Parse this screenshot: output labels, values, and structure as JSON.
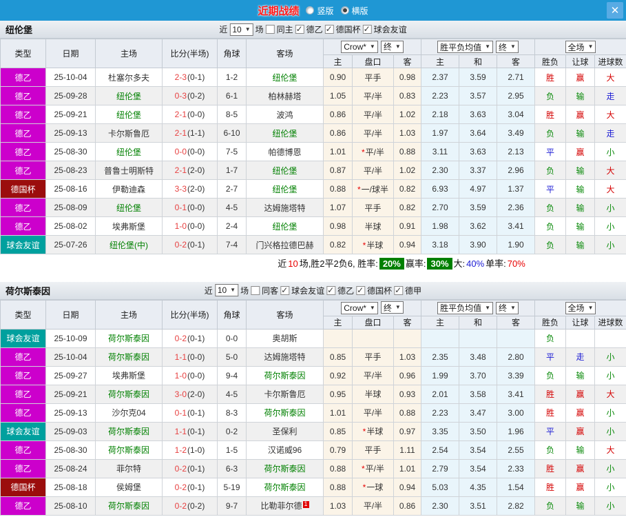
{
  "titlebar": {
    "title": "近期战绩",
    "options": [
      {
        "label": "竖版",
        "selected": false
      },
      {
        "label": "横版",
        "selected": true
      }
    ],
    "close_label": "✕"
  },
  "labels": {
    "near": "近",
    "games": "场"
  },
  "colors": {
    "header_bar": "#1f97d4",
    "league_de2": "#cc00cc",
    "league_cup": "#9b0d0d",
    "league_friendly": "#00a09e",
    "win_badge_bg": "#008000"
  },
  "type_colors": {
    "德乙": "#cc00cc",
    "德国杯": "#9b0d0d",
    "球会友谊": "#00a09e",
    "德甲": "#cc00cc"
  },
  "table_header": {
    "cols": [
      "类型",
      "日期",
      "主场",
      "比分(半场)",
      "角球",
      "客场"
    ],
    "sub": [
      "主",
      "盘口",
      "客",
      "主",
      "和",
      "客",
      "胜负",
      "让球",
      "进球数"
    ],
    "company": "Crow*",
    "final1": "终",
    "avg": "胜平负均值",
    "final2": "终",
    "scope": "全场"
  },
  "teams": [
    {
      "name": "纽伦堡",
      "filter": {
        "count": "10",
        "same": {
          "label": "同主",
          "checked": false
        },
        "leagues": [
          {
            "label": "德乙",
            "checked": true
          },
          {
            "label": "德国杯",
            "checked": true
          },
          {
            "label": "球会友谊",
            "checked": true
          }
        ]
      },
      "rows": [
        {
          "type": "德乙",
          "date": "25-10-04",
          "home": "杜塞尔多夫",
          "home_focus": false,
          "ft": "2-3",
          "ht": "(0-1)",
          "corner": "1-2",
          "away": "纽伦堡",
          "away_focus": true,
          "away_badge": "",
          "o1": "0.90",
          "star": "",
          "handicap": "平手",
          "o2": "0.98",
          "a1": "2.37",
          "a2": "3.59",
          "a3": "2.71",
          "r1": "胜",
          "r2": "赢",
          "r3": "大"
        },
        {
          "type": "德乙",
          "date": "25-09-28",
          "home": "纽伦堡",
          "home_focus": true,
          "ft": "0-3",
          "ht": "(0-2)",
          "corner": "6-1",
          "away": "柏林赫塔",
          "away_focus": false,
          "away_badge": "",
          "o1": "1.05",
          "star": "",
          "handicap": "平/半",
          "o2": "0.83",
          "a1": "2.23",
          "a2": "3.57",
          "a3": "2.95",
          "r1": "负",
          "r2": "输",
          "r3": "走"
        },
        {
          "type": "德乙",
          "date": "25-09-21",
          "home": "纽伦堡",
          "home_focus": true,
          "ft": "2-1",
          "ht": "(0-0)",
          "corner": "8-5",
          "away": "波鸿",
          "away_focus": false,
          "away_badge": "",
          "o1": "0.86",
          "star": "",
          "handicap": "平/半",
          "o2": "1.02",
          "a1": "2.18",
          "a2": "3.63",
          "a3": "3.04",
          "r1": "胜",
          "r2": "赢",
          "r3": "大"
        },
        {
          "type": "德乙",
          "date": "25-09-13",
          "home": "卡尔斯鲁厄",
          "home_focus": false,
          "ft": "2-1",
          "ht": "(1-1)",
          "corner": "6-10",
          "away": "纽伦堡",
          "away_focus": true,
          "away_badge": "",
          "o1": "0.86",
          "star": "",
          "handicap": "平/半",
          "o2": "1.03",
          "a1": "1.97",
          "a2": "3.64",
          "a3": "3.49",
          "r1": "负",
          "r2": "输",
          "r3": "走"
        },
        {
          "type": "德乙",
          "date": "25-08-30",
          "home": "纽伦堡",
          "home_focus": true,
          "ft": "0-0",
          "ht": "(0-0)",
          "corner": "7-5",
          "away": "帕德博恩",
          "away_focus": false,
          "away_badge": "",
          "o1": "1.01",
          "star": "*",
          "handicap": "平/半",
          "o2": "0.88",
          "a1": "3.11",
          "a2": "3.63",
          "a3": "2.13",
          "r1": "平",
          "r2": "赢",
          "r3": "小"
        },
        {
          "type": "德乙",
          "date": "25-08-23",
          "home": "普鲁士明斯特",
          "home_focus": false,
          "ft": "2-1",
          "ht": "(2-0)",
          "corner": "1-7",
          "away": "纽伦堡",
          "away_focus": true,
          "away_badge": "",
          "o1": "0.87",
          "star": "",
          "handicap": "平/半",
          "o2": "1.02",
          "a1": "2.30",
          "a2": "3.37",
          "a3": "2.96",
          "r1": "负",
          "r2": "输",
          "r3": "大"
        },
        {
          "type": "德国杯",
          "date": "25-08-16",
          "home": "伊勒迪森",
          "home_focus": false,
          "ft": "3-3",
          "ht": "(2-0)",
          "corner": "2-7",
          "away": "纽伦堡",
          "away_focus": true,
          "away_badge": "",
          "o1": "0.88",
          "star": "*",
          "handicap": "一/球半",
          "o2": "0.82",
          "a1": "6.93",
          "a2": "4.97",
          "a3": "1.37",
          "r1": "平",
          "r2": "输",
          "r3": "大"
        },
        {
          "type": "德乙",
          "date": "25-08-09",
          "home": "纽伦堡",
          "home_focus": true,
          "ft": "0-1",
          "ht": "(0-0)",
          "corner": "4-5",
          "away": "达姆施塔特",
          "away_focus": false,
          "away_badge": "",
          "o1": "1.07",
          "star": "",
          "handicap": "平手",
          "o2": "0.82",
          "a1": "2.70",
          "a2": "3.59",
          "a3": "2.36",
          "r1": "负",
          "r2": "输",
          "r3": "小"
        },
        {
          "type": "德乙",
          "date": "25-08-02",
          "home": "埃弗斯堡",
          "home_focus": false,
          "ft": "1-0",
          "ht": "(0-0)",
          "corner": "2-4",
          "away": "纽伦堡",
          "away_focus": true,
          "away_badge": "",
          "o1": "0.98",
          "star": "",
          "handicap": "半球",
          "o2": "0.91",
          "a1": "1.98",
          "a2": "3.62",
          "a3": "3.41",
          "r1": "负",
          "r2": "输",
          "r3": "小"
        },
        {
          "type": "球会友谊",
          "date": "25-07-26",
          "home": "纽伦堡(中)",
          "home_focus": true,
          "ft": "0-2",
          "ht": "(0-1)",
          "corner": "7-4",
          "away": "门兴格拉德巴赫",
          "away_focus": false,
          "away_badge": "",
          "o1": "0.82",
          "star": "*",
          "handicap": "半球",
          "o2": "0.94",
          "a1": "3.18",
          "a2": "3.90",
          "a3": "1.90",
          "r1": "负",
          "r2": "输",
          "r3": "小"
        }
      ],
      "summary": {
        "prefix": "近",
        "games": "10",
        "record": "场,胜2平2负6, 胜率:",
        "win": "20%",
        "cover_label": "赢率:",
        "cover": "30%",
        "big_label": "大:",
        "big": "40%",
        "single_label": "单率:",
        "single": "70%"
      }
    },
    {
      "name": "荷尔斯泰因",
      "filter": {
        "count": "10",
        "same": {
          "label": "同客",
          "checked": false
        },
        "leagues": [
          {
            "label": "球会友谊",
            "checked": true
          },
          {
            "label": "德乙",
            "checked": true
          },
          {
            "label": "德国杯",
            "checked": true
          },
          {
            "label": "德甲",
            "checked": true
          }
        ]
      },
      "rows": [
        {
          "type": "球会友谊",
          "date": "25-10-09",
          "home": "荷尔斯泰因",
          "home_focus": true,
          "ft": "0-2",
          "ht": "(0-1)",
          "corner": "0-0",
          "away": "奥胡斯",
          "away_focus": false,
          "away_badge": "",
          "o1": "",
          "star": "",
          "handicap": "",
          "o2": "",
          "a1": "",
          "a2": "",
          "a3": "",
          "r1": "负",
          "r2": "",
          "r3": ""
        },
        {
          "type": "德乙",
          "date": "25-10-04",
          "home": "荷尔斯泰因",
          "home_focus": true,
          "ft": "1-1",
          "ht": "(0-0)",
          "corner": "5-0",
          "away": "达姆施塔特",
          "away_focus": false,
          "away_badge": "",
          "o1": "0.85",
          "star": "",
          "handicap": "平手",
          "o2": "1.03",
          "a1": "2.35",
          "a2": "3.48",
          "a3": "2.80",
          "r1": "平",
          "r2": "走",
          "r3": "小"
        },
        {
          "type": "德乙",
          "date": "25-09-27",
          "home": "埃弗斯堡",
          "home_focus": false,
          "ft": "1-0",
          "ht": "(0-0)",
          "corner": "9-4",
          "away": "荷尔斯泰因",
          "away_focus": true,
          "away_badge": "",
          "o1": "0.92",
          "star": "",
          "handicap": "平/半",
          "o2": "0.96",
          "a1": "1.99",
          "a2": "3.70",
          "a3": "3.39",
          "r1": "负",
          "r2": "输",
          "r3": "小"
        },
        {
          "type": "德乙",
          "date": "25-09-21",
          "home": "荷尔斯泰因",
          "home_focus": true,
          "ft": "3-0",
          "ht": "(2-0)",
          "corner": "4-5",
          "away": "卡尔斯鲁厄",
          "away_focus": false,
          "away_badge": "",
          "o1": "0.95",
          "star": "",
          "handicap": "半球",
          "o2": "0.93",
          "a1": "2.01",
          "a2": "3.58",
          "a3": "3.41",
          "r1": "胜",
          "r2": "赢",
          "r3": "大"
        },
        {
          "type": "德乙",
          "date": "25-09-13",
          "home": "沙尔克04",
          "home_focus": false,
          "ft": "0-1",
          "ht": "(0-1)",
          "corner": "8-3",
          "away": "荷尔斯泰因",
          "away_focus": true,
          "away_badge": "",
          "o1": "1.01",
          "star": "",
          "handicap": "平/半",
          "o2": "0.88",
          "a1": "2.23",
          "a2": "3.47",
          "a3": "3.00",
          "r1": "胜",
          "r2": "赢",
          "r3": "小"
        },
        {
          "type": "球会友谊",
          "date": "25-09-03",
          "home": "荷尔斯泰因",
          "home_focus": true,
          "ft": "1-1",
          "ht": "(0-1)",
          "corner": "0-2",
          "away": "圣保利",
          "away_focus": false,
          "away_badge": "",
          "o1": "0.85",
          "star": "*",
          "handicap": "半球",
          "o2": "0.97",
          "a1": "3.35",
          "a2": "3.50",
          "a3": "1.96",
          "r1": "平",
          "r2": "赢",
          "r3": "小"
        },
        {
          "type": "德乙",
          "date": "25-08-30",
          "home": "荷尔斯泰因",
          "home_focus": true,
          "ft": "1-2",
          "ht": "(1-0)",
          "corner": "1-5",
          "away": "汉诺威96",
          "away_focus": false,
          "away_badge": "",
          "o1": "0.79",
          "star": "",
          "handicap": "平手",
          "o2": "1.11",
          "a1": "2.54",
          "a2": "3.54",
          "a3": "2.55",
          "r1": "负",
          "r2": "输",
          "r3": "大"
        },
        {
          "type": "德乙",
          "date": "25-08-24",
          "home": "菲尔特",
          "home_focus": false,
          "ft": "0-2",
          "ht": "(0-1)",
          "corner": "6-3",
          "away": "荷尔斯泰因",
          "away_focus": true,
          "away_badge": "",
          "o1": "0.88",
          "star": "*",
          "handicap": "平/半",
          "o2": "1.01",
          "a1": "2.79",
          "a2": "3.54",
          "a3": "2.33",
          "r1": "胜",
          "r2": "赢",
          "r3": "小"
        },
        {
          "type": "德国杯",
          "date": "25-08-18",
          "home": "侯姆堡",
          "home_focus": false,
          "ft": "0-2",
          "ht": "(0-1)",
          "corner": "5-19",
          "away": "荷尔斯泰因",
          "away_focus": true,
          "away_badge": "",
          "o1": "0.88",
          "star": "*",
          "handicap": "一球",
          "o2": "0.94",
          "a1": "5.03",
          "a2": "4.35",
          "a3": "1.54",
          "r1": "胜",
          "r2": "赢",
          "r3": "小"
        },
        {
          "type": "德乙",
          "date": "25-08-10",
          "home": "荷尔斯泰因",
          "home_focus": true,
          "ft": "0-2",
          "ht": "(0-2)",
          "corner": "9-7",
          "away": "比勒菲尔德",
          "away_focus": false,
          "away_badge": "1",
          "o1": "1.03",
          "star": "",
          "handicap": "平/半",
          "o2": "0.86",
          "a1": "2.30",
          "a2": "3.51",
          "a3": "2.82",
          "r1": "负",
          "r2": "输",
          "r3": "小"
        }
      ],
      "summary": null
    }
  ]
}
